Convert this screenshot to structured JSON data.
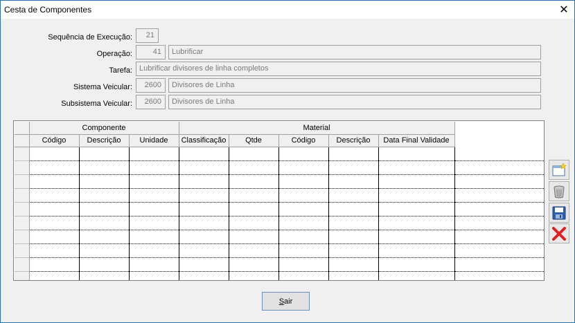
{
  "window": {
    "title": "Cesta de Componentes"
  },
  "form": {
    "sequencia": {
      "label": "Sequência de Execução:",
      "value": "21"
    },
    "operacao": {
      "label": "Operação:",
      "code": "41",
      "desc": "Lubrificar"
    },
    "tarefa": {
      "label": "Tarefa:",
      "desc": "Lubrificar divisores de linha completos"
    },
    "sistema": {
      "label": "Sistema Veicular:",
      "code": "2600",
      "desc": "Divisores de Linha"
    },
    "subsistema": {
      "label": "Subsistema Veicular:",
      "code": "2600",
      "desc": "Divisores de Linha"
    }
  },
  "grid": {
    "groups": [
      "Componente",
      "Material"
    ],
    "columns": [
      "Código",
      "Descrição",
      "Unidade",
      "Classificação",
      "Qtde",
      "Código",
      "Descrição",
      "Data Final Validade"
    ]
  },
  "toolbar": {
    "new_icon": "new-document-icon",
    "delete_icon": "trash-icon",
    "save_icon": "floppy-disk-icon",
    "cancel_icon": "red-x-icon"
  },
  "footer": {
    "sair_first": "S",
    "sair_rest": "air"
  }
}
